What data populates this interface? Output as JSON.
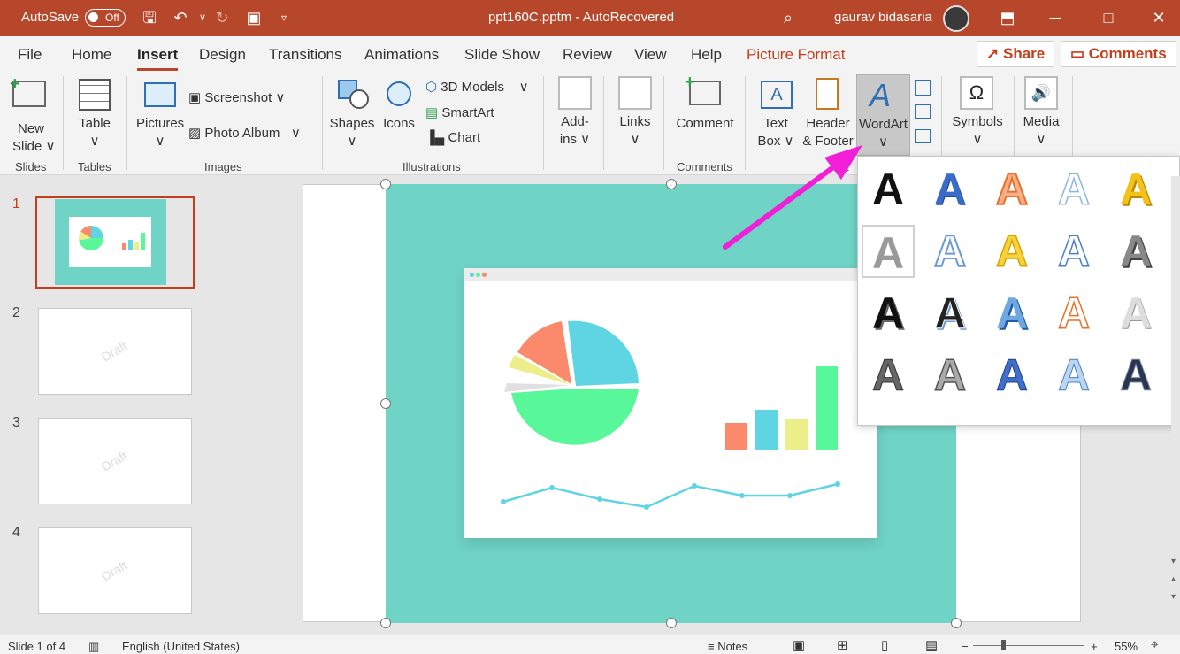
{
  "titlebar": {
    "autosave_label": "AutoSave",
    "autosave_state": "Off",
    "doc_title": "ppt160C.pptm  -  AutoRecovered",
    "user_name": "gaurav bidasaria"
  },
  "tabs": [
    "File",
    "Home",
    "Insert",
    "Design",
    "Transitions",
    "Animations",
    "Slide Show",
    "Review",
    "View",
    "Help",
    "Picture Format"
  ],
  "active_tab": "Insert",
  "header_buttons": {
    "share": "Share",
    "comments": "Comments"
  },
  "ribbon": {
    "slides": {
      "new_slide_1": "New",
      "new_slide_2": "Slide",
      "group": "Slides"
    },
    "tables": {
      "table": "Table",
      "group": "Tables"
    },
    "images": {
      "pictures": "Pictures",
      "screenshot": "Screenshot",
      "photo_album": "Photo Album",
      "group": "Images"
    },
    "illustrations": {
      "shapes": "Shapes",
      "icons": "Icons",
      "models": "3D Models",
      "smartart": "SmartArt",
      "chart": "Chart",
      "group": "Illustrations"
    },
    "addins": {
      "add_1": "Add-",
      "add_2": "ins"
    },
    "links": {
      "links": "Links"
    },
    "comments": {
      "comment": "Comment",
      "group": "Comments"
    },
    "text": {
      "textbox_1": "Text",
      "textbox_2": "Box",
      "header_1": "Header",
      "header_2": "& Footer",
      "wordart": "WordArt"
    },
    "symbols": {
      "symbols": "Symbols"
    },
    "media": {
      "media": "Media"
    }
  },
  "slides": [
    {
      "num": "1",
      "draft": ""
    },
    {
      "num": "2",
      "draft": "Draft"
    },
    {
      "num": "3",
      "draft": "Draft"
    },
    {
      "num": "4",
      "draft": "Draft"
    }
  ],
  "wordart_gallery": {
    "glyph": "A",
    "selected_index": 5,
    "styles": [
      "black-fill",
      "blue-fill",
      "orange-outline",
      "light-blue-outline",
      "gold-fill",
      "gray-fill",
      "blue-gradient",
      "gold-gradient",
      "blue-outline",
      "gray-gradient",
      "black-bold",
      "black-shadow",
      "blue-reflect",
      "orange-thin",
      "silver-fill",
      "gray-pattern",
      "gray-pattern-2",
      "blue-pattern",
      "blue-pattern-light",
      "dark-pattern"
    ]
  },
  "status": {
    "slide_info": "Slide 1 of 4",
    "language": "English (United States)",
    "notes": "Notes",
    "zoom": "55%"
  },
  "colors": {
    "accent": "#b7472a",
    "teal": "#6fd3c5",
    "arrow": "#f21ed8"
  }
}
